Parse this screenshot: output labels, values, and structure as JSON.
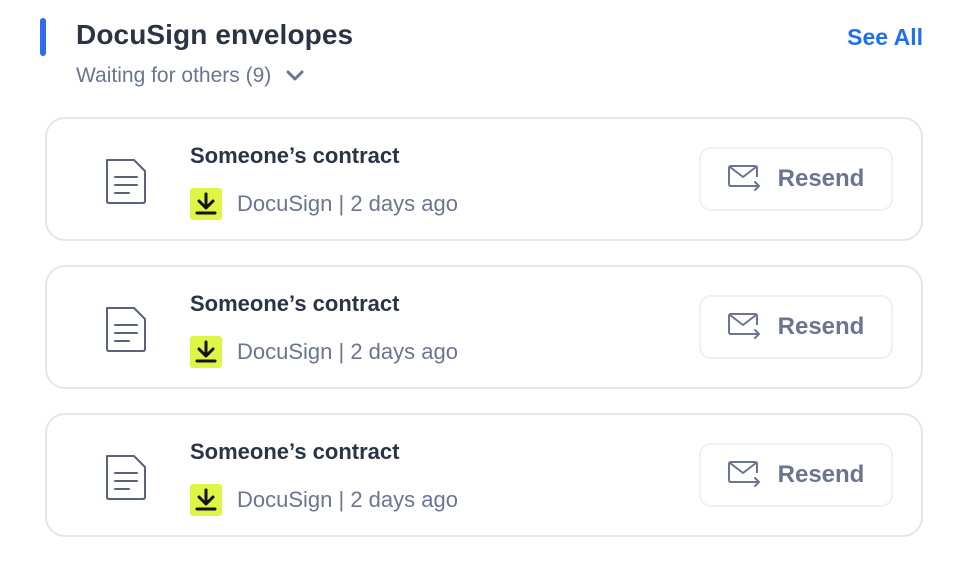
{
  "header": {
    "title": "DocuSign envelopes",
    "see_all_label": "See All",
    "filter_label": "Waiting for others (9)",
    "filter_icon": "chevron-down-icon"
  },
  "colors": {
    "accent": "#2f6bf2",
    "link": "#1f6ff2",
    "badge": "#dff545"
  },
  "envelopes": [
    {
      "title": "Someone’s contract",
      "meta": "DocuSign | 2 days ago",
      "action_label": "Resend",
      "icons": [
        "document-icon",
        "download-icon",
        "resend-mail-icon"
      ]
    },
    {
      "title": "Someone’s contract",
      "meta": "DocuSign | 2 days ago",
      "action_label": "Resend",
      "icons": [
        "document-icon",
        "download-icon",
        "resend-mail-icon"
      ]
    },
    {
      "title": "Someone’s contract",
      "meta": "DocuSign | 2 days ago",
      "action_label": "Resend",
      "icons": [
        "document-icon",
        "download-icon",
        "resend-mail-icon"
      ]
    }
  ]
}
